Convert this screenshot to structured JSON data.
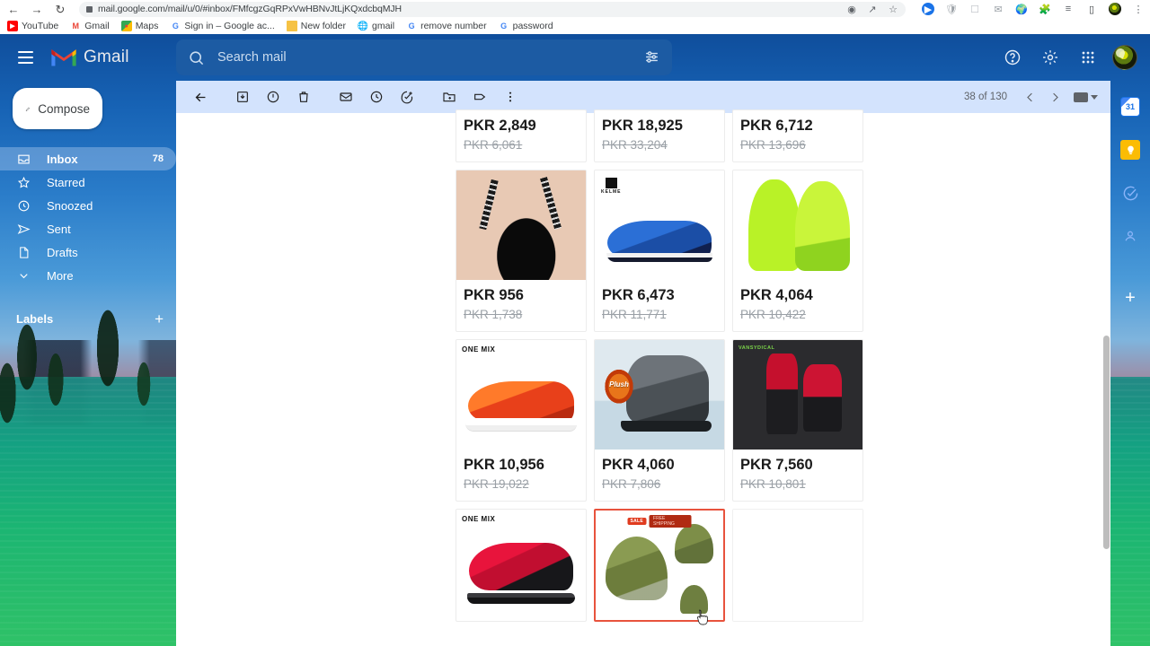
{
  "browser": {
    "url": "mail.google.com/mail/u/0/#inbox/FMfcgzGqRPxVwHBNvJtLjKQxdcbqMJH",
    "back_icon": "back-arrow-icon",
    "forward_icon": "forward-arrow-icon",
    "reload_icon": "reload-icon",
    "lock_icon": "site-info-icon",
    "omnibox_icons": [
      "translate-icon",
      "share-icon",
      "bookmark-star-icon"
    ],
    "extension_icons": [
      "extension-blue-icon",
      "shield-icon",
      "screenshot-icon",
      "mail-extension-icon",
      "globe-icon",
      "puzzle-icon",
      "reading-list-icon",
      "side-panel-icon"
    ],
    "menu_icon": "kebab-menu-icon",
    "bookmarks": [
      {
        "label": "YouTube",
        "icon": "youtube-icon",
        "color": "#ff0000"
      },
      {
        "label": "Gmail",
        "icon": "gmail-icon",
        "color": "#ea4335"
      },
      {
        "label": "Maps",
        "icon": "maps-icon",
        "color": "#34a853"
      },
      {
        "label": "Sign in – Google ac...",
        "icon": "google-icon",
        "color": "#4285f4"
      },
      {
        "label": "New folder",
        "icon": "folder-icon",
        "color": "#f6c244"
      },
      {
        "label": "gmail",
        "icon": "globe-icon",
        "color": "#3c4043"
      },
      {
        "label": "remove number",
        "icon": "google-icon",
        "color": "#4285f4"
      },
      {
        "label": "password",
        "icon": "google-icon",
        "color": "#4285f4"
      }
    ]
  },
  "gmail": {
    "header": {
      "menu_icon": "hamburger-menu-icon",
      "logo_icon": "gmail-m-logo-icon",
      "brand": "Gmail",
      "help_icon": "help-circle-icon",
      "settings_icon": "gear-icon",
      "apps_icon": "apps-grid-icon",
      "avatar_icon": "account-avatar"
    },
    "search": {
      "placeholder": "Search mail",
      "value": "",
      "search_icon": "search-icon",
      "filter_icon": "search-options-icon"
    },
    "compose": {
      "label": "Compose",
      "icon": "pencil-icon"
    },
    "nav": [
      {
        "label": "Inbox",
        "icon": "inbox-icon",
        "count": "78",
        "active": true
      },
      {
        "label": "Starred",
        "icon": "star-icon",
        "count": "",
        "active": false
      },
      {
        "label": "Snoozed",
        "icon": "clock-icon",
        "count": "",
        "active": false
      },
      {
        "label": "Sent",
        "icon": "send-icon",
        "count": "",
        "active": false
      },
      {
        "label": "Drafts",
        "icon": "draft-icon",
        "count": "",
        "active": false
      },
      {
        "label": "More",
        "icon": "chevron-down-icon",
        "count": "",
        "active": false
      }
    ],
    "labels": {
      "title": "Labels",
      "add_icon": "plus-icon"
    },
    "toolbar": {
      "back_icon": "back-arrow-icon",
      "archive_icon": "archive-icon",
      "spam_icon": "report-spam-icon",
      "delete_icon": "trash-icon",
      "unread_icon": "mark-unread-icon",
      "snooze_icon": "snooze-clock-icon",
      "task_icon": "add-to-tasks-icon",
      "move_icon": "move-to-folder-icon",
      "label_icon": "label-tag-icon",
      "more_icon": "more-vertical-icon"
    },
    "pager": {
      "range": "38 of 130",
      "prev_icon": "chevron-left-icon",
      "next_icon": "chevron-right-icon",
      "keyboard_icon": "keyboard-shortcut-icon",
      "caret_icon": "chevron-down-icon"
    },
    "side_rail": [
      {
        "name": "calendar",
        "icon": "calendar-31-icon"
      },
      {
        "name": "keep",
        "icon": "keep-lightbulb-icon"
      },
      {
        "name": "tasks",
        "icon": "tasks-check-icon"
      },
      {
        "name": "contacts",
        "icon": "contacts-icon"
      },
      {
        "name": "add-ons",
        "icon": "plus-icon"
      }
    ]
  },
  "products": {
    "rows": [
      [
        {
          "price": "PKR 2,849",
          "original": "PKR 6,061",
          "art": "art-bra-top",
          "cut_top": true
        },
        {
          "price": "PKR 18,925",
          "original": "PKR 33,204",
          "art": "art-generic",
          "cut_top": true
        },
        {
          "price": "PKR 6,712",
          "original": "PKR 13,696",
          "art": "art-generic",
          "cut_top": true
        }
      ],
      [
        {
          "price": "PKR 956",
          "original": "PKR 1,738",
          "art": "art-bra"
        },
        {
          "price": "PKR 6,473",
          "original": "PKR 11,771",
          "art": "art-shoe-blue",
          "brand": "KELME"
        },
        {
          "price": "PKR 4,064",
          "original": "PKR 10,422",
          "art": "art-gloves"
        }
      ],
      [
        {
          "price": "PKR 10,956",
          "original": "PKR 19,022",
          "art": "art-sneaker-orange",
          "brand": "ONE MIX"
        },
        {
          "price": "PKR 4,060",
          "original": "PKR 7,806",
          "art": "art-boot",
          "badge": "Plush"
        },
        {
          "price": "PKR 7,560",
          "original": "PKR 10,801",
          "art": "art-tracksuit",
          "brand": "VANSYDICAL"
        }
      ],
      [
        {
          "price": "",
          "original": "",
          "art": "art-sneaker-red",
          "brand": "ONE MIX"
        },
        {
          "price": "",
          "original": "",
          "art": "art-hats",
          "highlight": true,
          "banner1": "SALE",
          "banner2": "FREE SHIPPING"
        },
        {
          "price": "",
          "original": "",
          "art": "art-empty"
        }
      ]
    ]
  },
  "colors": {
    "gmail_blue": "#0f4e9c",
    "toolbar_blue": "#d3e3fd",
    "search_blue": "#1c5ba3",
    "price_text": "#1a1a1a",
    "old_price": "#9aa0a6",
    "highlight_border": "#e8533d"
  }
}
